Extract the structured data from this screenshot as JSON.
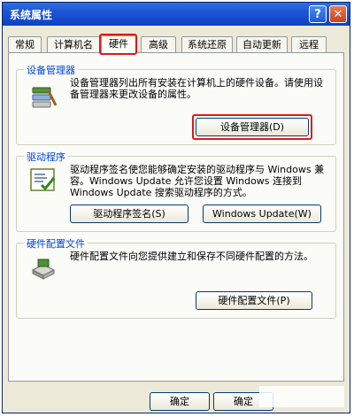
{
  "window": {
    "title": "系统属性",
    "help_label": "?",
    "close_label": "✕"
  },
  "tabs": [
    {
      "label": "常规",
      "active": false
    },
    {
      "label": "计算机名",
      "active": false
    },
    {
      "label": "硬件",
      "active": true
    },
    {
      "label": "高级",
      "active": false
    },
    {
      "label": "系统还原",
      "active": false
    },
    {
      "label": "自动更新",
      "active": false
    },
    {
      "label": "远程",
      "active": false
    }
  ],
  "device_manager": {
    "title": "设备管理器",
    "description": "设备管理器列出所有安装在计算机上的硬件设备。请使用设备管理器来更改设备的属性。",
    "button": "设备管理器(D)",
    "icon": "device-manager-icon"
  },
  "drivers": {
    "title": "驱动程序",
    "description": "驱动程序签名使您能够确定安装的驱动程序与 Windows 兼容。Windows Update 允许您设置 Windows 连接到 Windows Update 搜索驱动程序的方式。",
    "signing_button": "驱动程序签名(S)",
    "update_button": "Windows Update(W)",
    "icon": "driver-signing-icon"
  },
  "hardware_profiles": {
    "title": "硬件配置文件",
    "description": "硬件配置文件向您提供建立和保存不同硬件配置的方法。",
    "button": "硬件配置文件(P)",
    "icon": "hardware-profile-icon"
  },
  "footer": {
    "ok_label": "确定",
    "ok_label_2": "确定"
  },
  "colors": {
    "highlight": "#e01818",
    "titlebar": "#0c41c0",
    "group_title": "#0046d5"
  }
}
